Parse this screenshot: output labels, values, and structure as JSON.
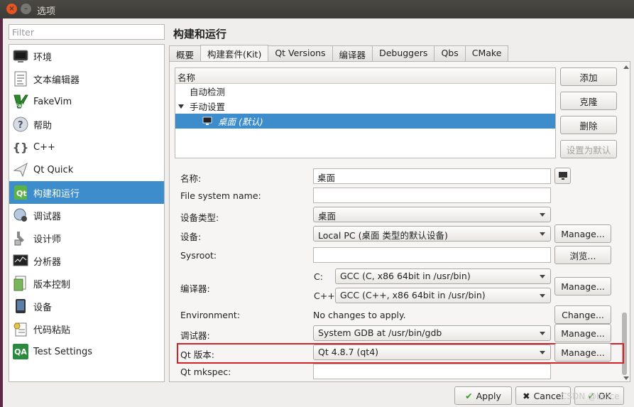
{
  "window": {
    "title": "选项"
  },
  "sidebar": {
    "filter_placeholder": "Filter",
    "items": [
      {
        "label": "环境",
        "icon": "monitor-icon"
      },
      {
        "label": "文本编辑器",
        "icon": "text-editor-icon"
      },
      {
        "label": "FakeVim",
        "icon": "fakevim-icon"
      },
      {
        "label": "帮助",
        "icon": "help-icon"
      },
      {
        "label": "C++",
        "icon": "braces-icon"
      },
      {
        "label": "Qt Quick",
        "icon": "qtquick-icon"
      },
      {
        "label": "构建和运行",
        "icon": "qt-build-icon"
      },
      {
        "label": "调试器",
        "icon": "debugger-icon"
      },
      {
        "label": "设计师",
        "icon": "designer-icon"
      },
      {
        "label": "分析器",
        "icon": "analyzer-icon"
      },
      {
        "label": "版本控制",
        "icon": "version-control-icon"
      },
      {
        "label": "设备",
        "icon": "device-icon"
      },
      {
        "label": "代码粘贴",
        "icon": "code-paste-icon"
      },
      {
        "label": "Test Settings",
        "icon": "qa-icon"
      }
    ]
  },
  "main": {
    "title": "构建和运行",
    "tabs": [
      "概要",
      "构建套件(Kit)",
      "Qt Versions",
      "编译器",
      "Debuggers",
      "Qbs",
      "CMake"
    ],
    "active_tab": 1,
    "tree": {
      "header": "名称",
      "auto_detect": "自动检测",
      "manual": "手动设置",
      "kit": "桌面 (默认)"
    },
    "kit_buttons": {
      "add": "添加",
      "clone": "克隆",
      "remove": "删除",
      "set_default": "设置为默认"
    },
    "form": {
      "name_label": "名称:",
      "name_value": "桌面",
      "fs_label": "File system name:",
      "fs_value": "",
      "device_type_label": "设备类型:",
      "device_type_value": "桌面",
      "device_label": "设备:",
      "device_value": "Local PC (桌面 类型的默认设备)",
      "sysroot_label": "Sysroot:",
      "sysroot_value": "",
      "browse": "浏览...",
      "compiler_label": "编译器:",
      "c_label": "C:",
      "c_value": "GCC (C, x86 64bit in /usr/bin)",
      "cpp_label": "C++:",
      "cpp_value": "GCC (C++, x86 64bit in /usr/bin)",
      "env_label": "Environment:",
      "env_value": "No changes to apply.",
      "change": "Change...",
      "debugger_label": "调试器:",
      "debugger_value": "System GDB at /usr/bin/gdb",
      "qt_label": "Qt 版本:",
      "qt_value": "Qt 4.8.7 (qt4)",
      "mkspec_label": "Qt mkspec:",
      "mkspec_value": "",
      "manage": "Manage..."
    }
  },
  "footer": {
    "apply": "Apply",
    "cancel": "Cancel",
    "ok": "OK",
    "watermark": "CSDN @bdice"
  },
  "colors": {
    "selection": "#3d8ccb",
    "highlight_border": "#d2222a",
    "titlebar": "#3c3b37",
    "close": "#e95420"
  }
}
